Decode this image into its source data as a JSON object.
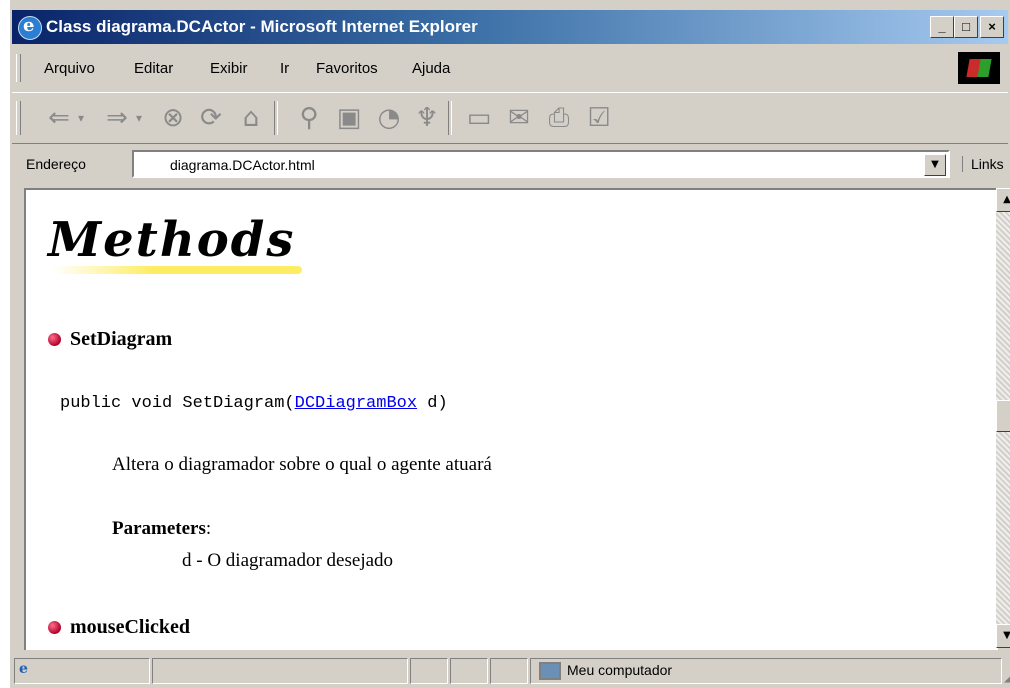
{
  "window": {
    "title": "Class diagrama.DCActor - Microsoft Internet Explorer",
    "min": "_",
    "max": "□",
    "close": "×"
  },
  "menu": [
    {
      "label": "Arquivo"
    },
    {
      "label": "Editar"
    },
    {
      "label": "Exibir"
    },
    {
      "label": "Ir"
    },
    {
      "label": "Favoritos"
    },
    {
      "label": "Ajuda"
    }
  ],
  "toolbar_icons": [
    "back-icon",
    "back-dropdown-icon",
    "forward-icon",
    "forward-dropdown-icon",
    "stop-icon",
    "refresh-icon",
    "home-icon",
    "search-icon",
    "favorites-icon",
    "history-icon",
    "channels-icon",
    "fullscreen-icon",
    "mail-icon",
    "print-icon",
    "edit-icon"
  ],
  "address": {
    "label": "Endereço",
    "value": "diagrama.DCActor.html",
    "links": "Links"
  },
  "page": {
    "heading": "Methods",
    "methods": [
      {
        "name": "SetDiagram"
      },
      {
        "name": "mouseClicked"
      }
    ],
    "signature_prefix": "public void SetDiagram(",
    "signature_link": "DCDiagramBox",
    "signature_suffix": " d)",
    "description": "Altera o diagramador sobre o qual o agente atuará",
    "params_label": "Parameters",
    "params_colon": ":",
    "param": "d - O diagramador desejado"
  },
  "status": {
    "zone": "Meu computador"
  }
}
